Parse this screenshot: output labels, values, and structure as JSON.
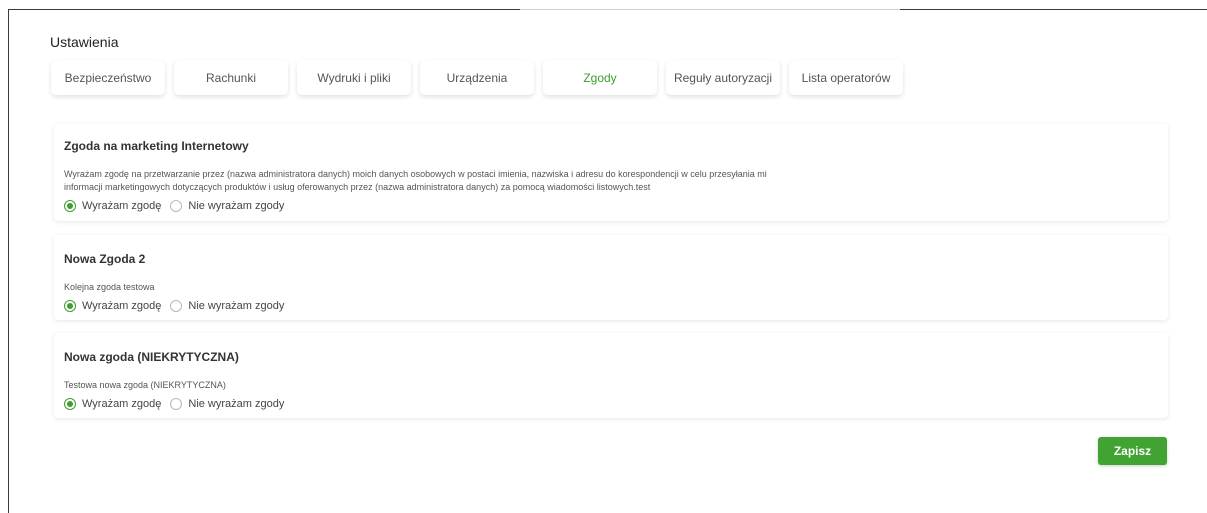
{
  "page": {
    "title": "Ustawienia"
  },
  "tabs": [
    {
      "label": "Bezpieczeństwo",
      "active": false
    },
    {
      "label": "Rachunki",
      "active": false
    },
    {
      "label": "Wydruki i pliki",
      "active": false
    },
    {
      "label": "Urządzenia",
      "active": false
    },
    {
      "label": "Zgody",
      "active": true
    },
    {
      "label": "Reguły autoryzacji",
      "active": false
    },
    {
      "label": "Lista operatorów",
      "active": false
    }
  ],
  "consents": [
    {
      "title": "Zgoda na marketing Internetowy",
      "text": "Wyrażam zgodę na przetwarzanie przez (nazwa administratora danych) moich danych osobowych w postaci imienia, nazwiska i adresu do korespondencji w celu przesyłania mi informacji marketingowych dotyczących produktów i usług oferowanych przez (nazwa administratora danych) za pomocą wiadomości listowych.test",
      "agree_label": "Wyrażam zgodę",
      "disagree_label": "Nie wyrażam zgody",
      "selected": "agree"
    },
    {
      "title": "Nowa Zgoda 2",
      "text": "Kolejna zgoda testowa",
      "agree_label": "Wyrażam zgodę",
      "disagree_label": "Nie wyrażam zgody",
      "selected": "agree"
    },
    {
      "title": "Nowa zgoda (NIEKRYTYCZNA)",
      "text": "Testowa nowa zgoda (NIEKRYTYCZNA)",
      "agree_label": "Wyrażam zgodę",
      "disagree_label": "Nie wyrażam zgody",
      "selected": "agree"
    }
  ],
  "actions": {
    "save_label": "Zapisz"
  },
  "colors": {
    "accent": "#41a332",
    "active_tab_text": "#3f9d2f"
  }
}
